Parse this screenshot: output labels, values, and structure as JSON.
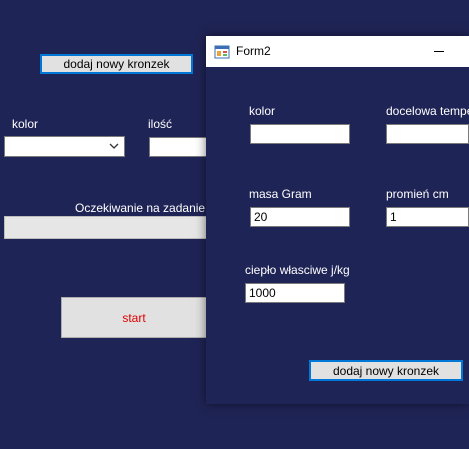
{
  "main_form": {
    "add_button_label": "dodaj nowy kronzek",
    "color_label": "kolor",
    "color_value": "",
    "quantity_label": "ilość",
    "quantity_value": "",
    "status_text": "Oczekiwanie na zadanie",
    "progress_fraction": 0,
    "start_button_label": "start",
    "start_color": "#e00000"
  },
  "form2": {
    "title": "Form2",
    "color_label": "kolor",
    "color_value": "",
    "target_temp_label": "docelowa tempera",
    "target_temp_value": "",
    "mass_label": "masa Gram",
    "mass_value": "20",
    "radius_label": "promień cm",
    "radius_value": "1",
    "specific_heat_label": "ciepło własciwe j/kg",
    "specific_heat_value": "1000",
    "add_button_label": "dodaj nowy kronzek"
  },
  "icons": {
    "app_icon": "form-app-icon",
    "minimize": "minimize-icon",
    "dropdown": "chevron-down-icon"
  },
  "colors": {
    "background": "#1f2456",
    "accent": "#0078d7"
  }
}
